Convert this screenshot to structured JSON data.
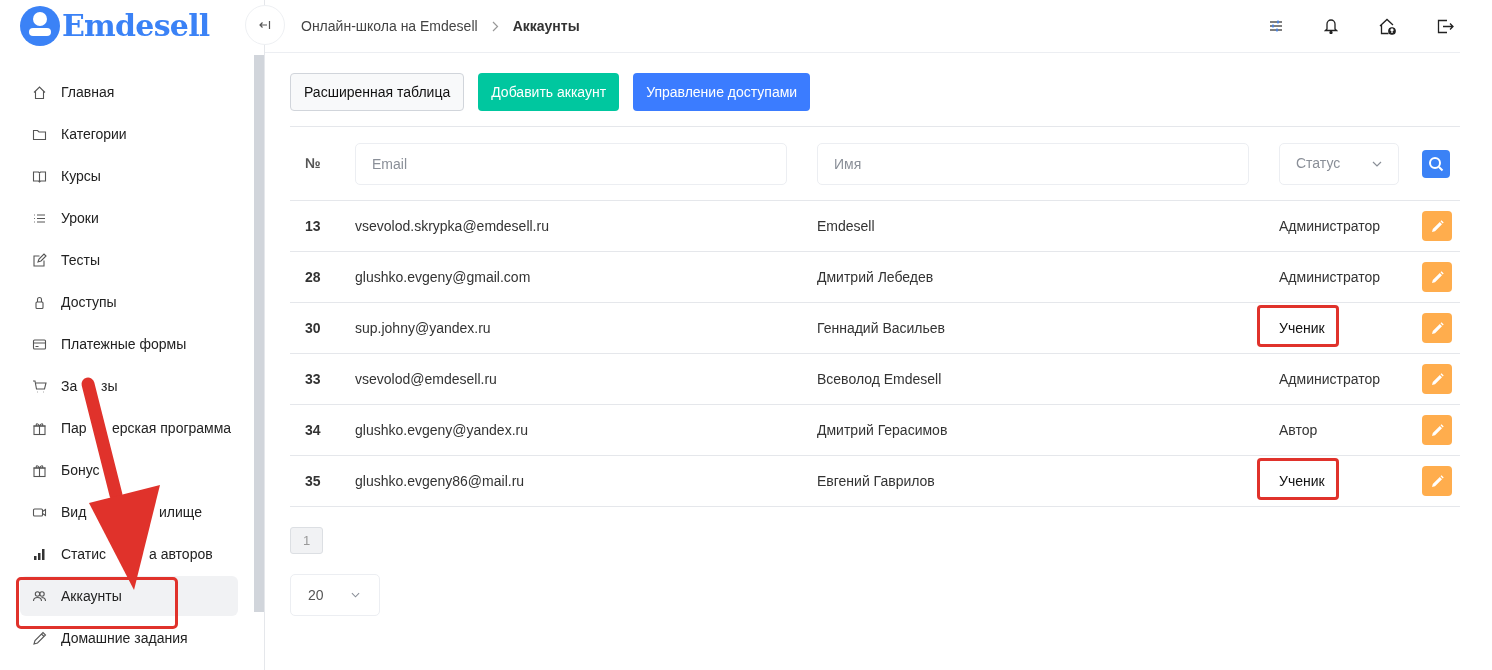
{
  "logo": {
    "text": "Emdesell"
  },
  "sidebar": {
    "items": [
      {
        "label": "Главная",
        "selected": false
      },
      {
        "label": "Категории",
        "selected": false
      },
      {
        "label": "Курсы",
        "selected": false
      },
      {
        "label": "Уроки",
        "selected": false
      },
      {
        "label": "Тесты",
        "selected": false
      },
      {
        "label": "Доступы",
        "selected": false
      },
      {
        "label": "Платежные формы",
        "selected": false
      },
      {
        "label_parts": [
          "За",
          "зы"
        ],
        "selected": false
      },
      {
        "label_parts": [
          "Пар",
          "ерская программа"
        ],
        "selected": false
      },
      {
        "label": "Бонус",
        "selected": false
      },
      {
        "label_parts": [
          "Вид",
          "илище"
        ],
        "selected": false
      },
      {
        "label_parts": [
          "Статис",
          "а авторов"
        ],
        "selected": false
      },
      {
        "label": "Аккаунты",
        "selected": true
      },
      {
        "label": "Домашние задания",
        "selected": false
      }
    ]
  },
  "breadcrumbs": [
    {
      "label": "Онлайн-школа на Emdesell",
      "current": false
    },
    {
      "label": "Аккаунты",
      "current": true
    }
  ],
  "toolbar": {
    "buttons": [
      {
        "label": "Расширенная таблица",
        "kind": "light"
      },
      {
        "label": "Добавить аккаунт",
        "kind": "green"
      },
      {
        "label": "Управление доступами",
        "kind": "blue"
      }
    ]
  },
  "table": {
    "columns": {
      "number": "№",
      "email_placeholder": "Email",
      "name_placeholder": "Имя",
      "status_placeholder": "Статус"
    },
    "rows": [
      {
        "id": "13",
        "email": "vsevolod.skrypka@emdesell.ru",
        "name": "Emdesell",
        "status": "Администратор",
        "highlighted": false
      },
      {
        "id": "28",
        "email": "glushko.evgeny@gmail.com",
        "name": "Дмитрий Лебедев",
        "status": "Администратор",
        "highlighted": false
      },
      {
        "id": "30",
        "email": "sup.johny@yandex.ru",
        "name": "Геннадий Васильев",
        "status": "Ученик",
        "highlighted": true
      },
      {
        "id": "33",
        "email": "vsevolod@emdesell.ru",
        "name": "Всеволод Emdesell",
        "status": "Администратор",
        "highlighted": false
      },
      {
        "id": "34",
        "email": "glushko.evgeny@yandex.ru",
        "name": "Дмитрий Герасимов",
        "status": "Автор",
        "highlighted": false
      },
      {
        "id": "35",
        "email": "glushko.evgeny86@mail.ru",
        "name": "Евгений Гаврилов",
        "status": "Ученик",
        "highlighted": true
      }
    ]
  },
  "pagination": {
    "pages": [
      {
        "label": "1",
        "selected": true
      }
    ]
  },
  "page_size": {
    "value": "20"
  },
  "annotations": {
    "sidebar_highlight": true,
    "arrow": true
  }
}
